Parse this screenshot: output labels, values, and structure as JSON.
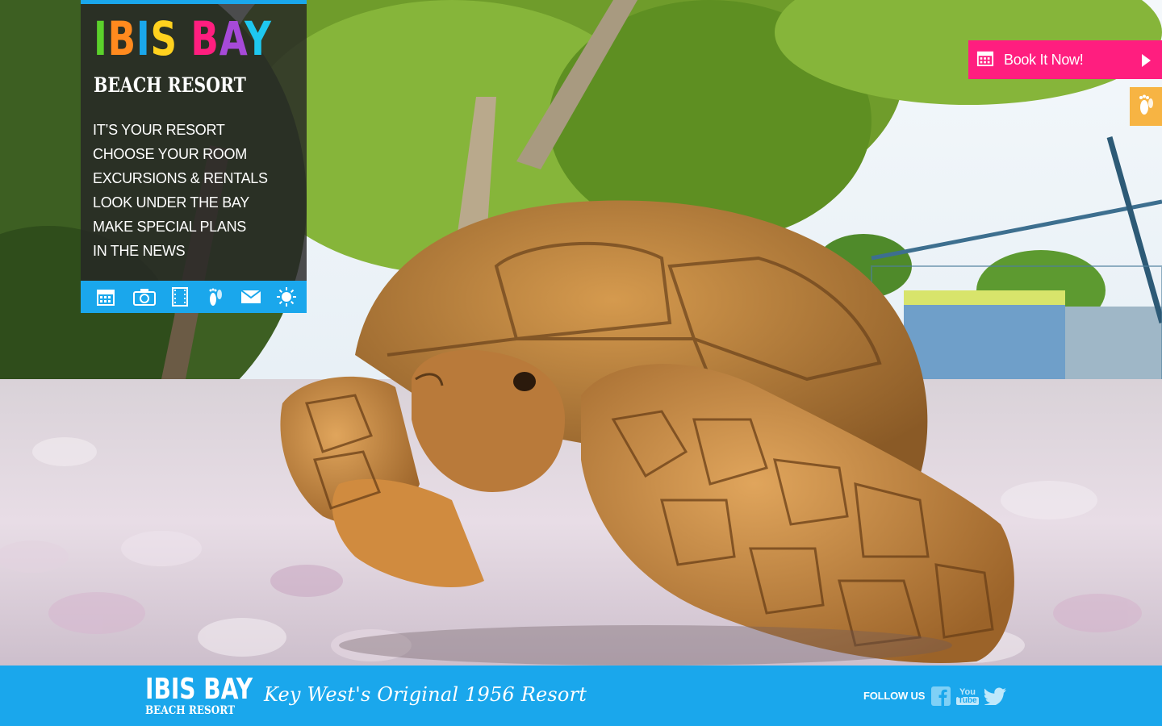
{
  "brand": {
    "logo_letters": [
      {
        "char": "I",
        "color": "#5bd12b"
      },
      {
        "char": "B",
        "color": "#ff8a1e"
      },
      {
        "char": "I",
        "color": "#1aa7ec"
      },
      {
        "char": "S",
        "color": "#ffd11e"
      },
      {
        "char": " ",
        "color": "#ffffff"
      },
      {
        "char": "B",
        "color": "#ff1e7f"
      },
      {
        "char": "A",
        "color": "#a64ad8"
      },
      {
        "char": "Y",
        "color": "#1ec8f0"
      }
    ],
    "logo_subtitle": "BEACH RESORT"
  },
  "nav": {
    "items": [
      {
        "label": "IT’S YOUR RESORT"
      },
      {
        "label": "CHOOSE YOUR ROOM"
      },
      {
        "label": "EXCURSIONS & RENTALS"
      },
      {
        "label": "LOOK UNDER THE BAY"
      },
      {
        "label": "MAKE SPECIAL PLANS"
      },
      {
        "label": "IN THE NEWS"
      }
    ],
    "icon_bar": [
      "calendar-icon",
      "camera-icon",
      "film-icon",
      "footprints-icon",
      "mail-icon",
      "sun-icon"
    ]
  },
  "booking": {
    "label": "Book It Now!",
    "icon": "calendar-icon",
    "side_tab_icon": "footprints-icon"
  },
  "hero": {
    "image": "tortoise-on-seashells-photo"
  },
  "footer": {
    "logo_title": "IBIS BAY",
    "logo_subtitle": "BEACH RESORT",
    "tagline": "Key West's Original 1956 Resort",
    "follow_label": "FOLLOW US",
    "social": [
      "facebook-icon",
      "youtube-icon",
      "twitter-icon"
    ],
    "youtube_top": "You",
    "youtube_bottom": "Tube"
  },
  "colors": {
    "accent_blue": "#1aa7ec",
    "book_pink": "#ff1e7f",
    "tab_orange": "#f7b443",
    "panel_dark": "#262626"
  }
}
